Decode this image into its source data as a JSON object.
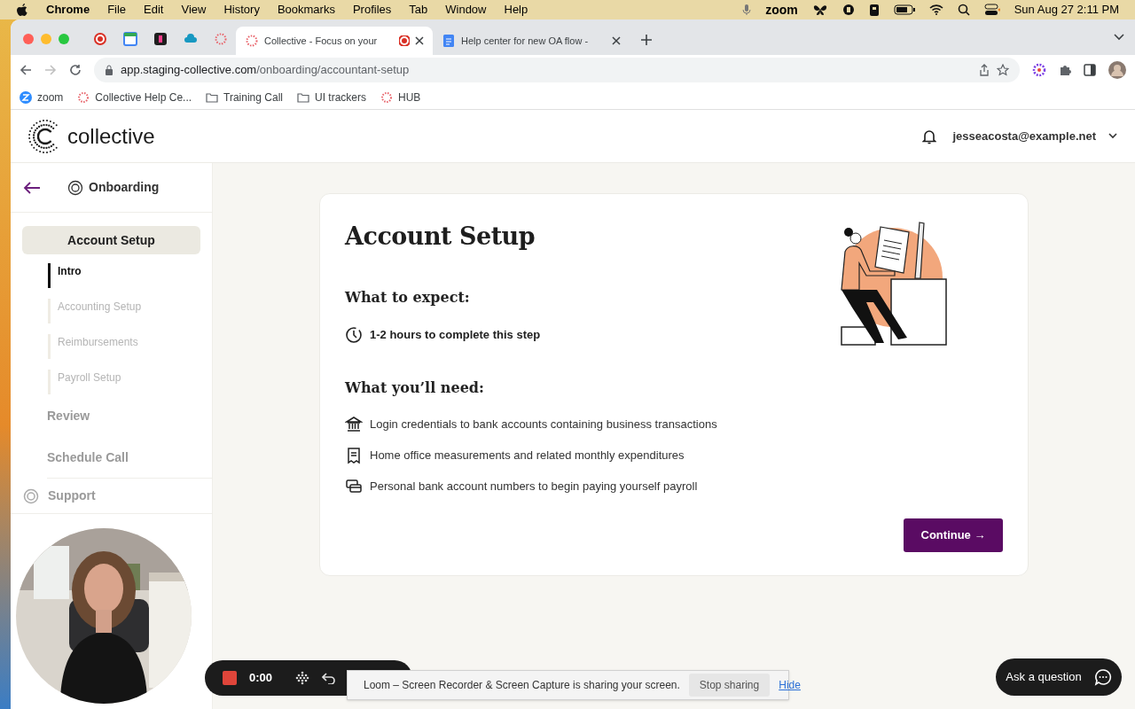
{
  "menubar": {
    "app": "Chrome",
    "menus": [
      "File",
      "Edit",
      "View",
      "History",
      "Bookmarks",
      "Profiles",
      "Tab",
      "Window",
      "Help"
    ],
    "zoom_label": "zoom",
    "clock": "Sun Aug 27  2:11 PM"
  },
  "browser": {
    "tabs": [
      {
        "kind": "pinned",
        "selected": false
      },
      {
        "kind": "pinned",
        "selected": false
      },
      {
        "kind": "pinned",
        "selected": false
      },
      {
        "kind": "pinned",
        "selected": false
      },
      {
        "kind": "pinned",
        "selected": false
      },
      {
        "kind": "tab",
        "title": "Collective - Focus on your",
        "selected": true
      },
      {
        "kind": "tab",
        "title": "Help center for new OA flow -",
        "selected": false
      }
    ],
    "url_host": "app.staging-collective.com",
    "url_path": "/onboarding/accountant-setup",
    "bookmarks": [
      {
        "kind": "zoom",
        "label": "zoom"
      },
      {
        "kind": "collective",
        "label": "Collective Help Ce..."
      },
      {
        "kind": "folder",
        "label": "Training Call"
      },
      {
        "kind": "folder",
        "label": "UI trackers"
      },
      {
        "kind": "collective",
        "label": "HUB"
      }
    ]
  },
  "header": {
    "brand": "collective",
    "user": "jesseacosta@example.net"
  },
  "sidebar": {
    "title": "Onboarding",
    "section": "Account Setup",
    "steps": [
      {
        "label": "Intro",
        "selected": true
      },
      {
        "label": "Accounting Setup",
        "selected": false
      },
      {
        "label": "Reimbursements",
        "selected": false
      },
      {
        "label": "Payroll Setup",
        "selected": false
      }
    ],
    "items": [
      "Review",
      "Schedule Call"
    ],
    "support": "Support"
  },
  "card": {
    "title": "Account Setup",
    "expect_heading": "What to expect:",
    "expect": [
      {
        "text": "1-2 hours to complete this step"
      }
    ],
    "need_heading": "What you’ll need:",
    "needs": [
      {
        "text": "Login credentials to bank accounts containing business transactions"
      },
      {
        "text": "Home office measurements and related monthly expenditures"
      },
      {
        "text": "Personal bank account numbers to begin paying yourself payroll"
      }
    ],
    "button": "Continue →"
  },
  "recorder": {
    "time": "0:00"
  },
  "share_banner": {
    "text": "Loom – Screen Recorder & Screen Capture is sharing your screen.",
    "stop": "Stop sharing",
    "hide": "Hide"
  },
  "help_button": "Ask a question"
}
